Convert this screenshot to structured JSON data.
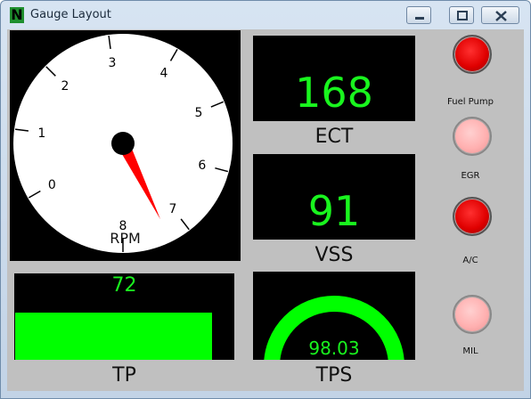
{
  "window": {
    "title": "Gauge Layout",
    "icon_letter": "N",
    "buttons": [
      "minimize-icon",
      "maximize-icon",
      "close-icon"
    ]
  },
  "rpm_gauge": {
    "label": "RPM",
    "ticks": [
      "0",
      "1",
      "2",
      "3",
      "4",
      "5",
      "6",
      "7",
      "8"
    ],
    "value": 7.3,
    "needle_color": "#ff0000"
  },
  "ect": {
    "value": "168",
    "label": "ECT"
  },
  "vss": {
    "value": "91",
    "label": "VSS"
  },
  "tp": {
    "value": "72",
    "label": "TP",
    "fill_fraction": 0.9,
    "fill_color": "#00ff00"
  },
  "tps": {
    "value": "98.03",
    "label": "TPS",
    "fraction": 0.98
  },
  "lamps": [
    {
      "label": "Fuel Pump",
      "state": "on",
      "color": "#ff1010"
    },
    {
      "label": "EGR",
      "state": "off",
      "color": "#ffb0b0"
    },
    {
      "label": "A/C",
      "state": "on",
      "color": "#ff1010"
    },
    {
      "label": "MIL",
      "state": "off",
      "color": "#ffb0b0"
    }
  ],
  "colors": {
    "digit_green": "#19f51e",
    "background_gray": "#c0c0c0"
  }
}
